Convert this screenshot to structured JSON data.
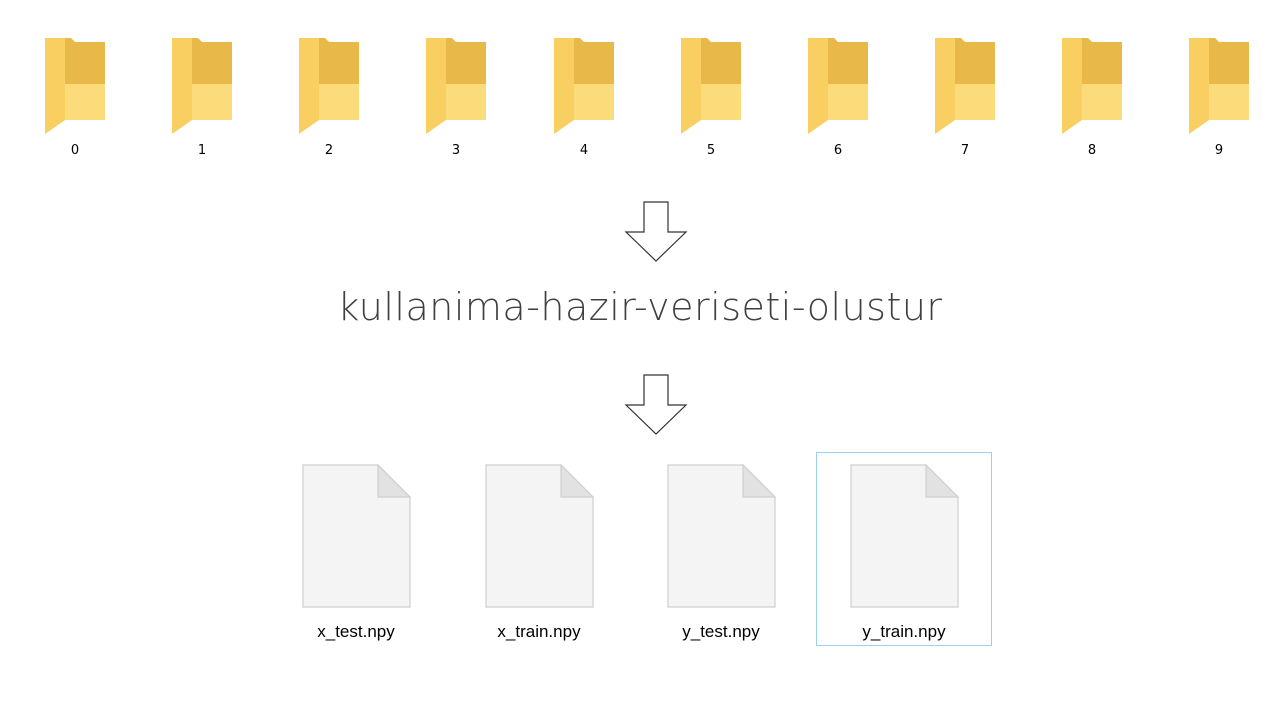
{
  "folders": [
    {
      "label": "0"
    },
    {
      "label": "1"
    },
    {
      "label": "2"
    },
    {
      "label": "3"
    },
    {
      "label": "4"
    },
    {
      "label": "5"
    },
    {
      "label": "6"
    },
    {
      "label": "7"
    },
    {
      "label": "8"
    },
    {
      "label": "9"
    }
  ],
  "process": {
    "label": "kullanima-hazir-veriseti-olustur"
  },
  "files": [
    {
      "label": "x_test.npy"
    },
    {
      "label": "x_train.npy"
    },
    {
      "label": "y_test.npy"
    },
    {
      "label": "y_train.npy"
    }
  ],
  "colors": {
    "folder_back": "#E8B948",
    "folder_front": "#FCD974",
    "selection_border": "#99D1EF",
    "text_dark": "#404040"
  }
}
